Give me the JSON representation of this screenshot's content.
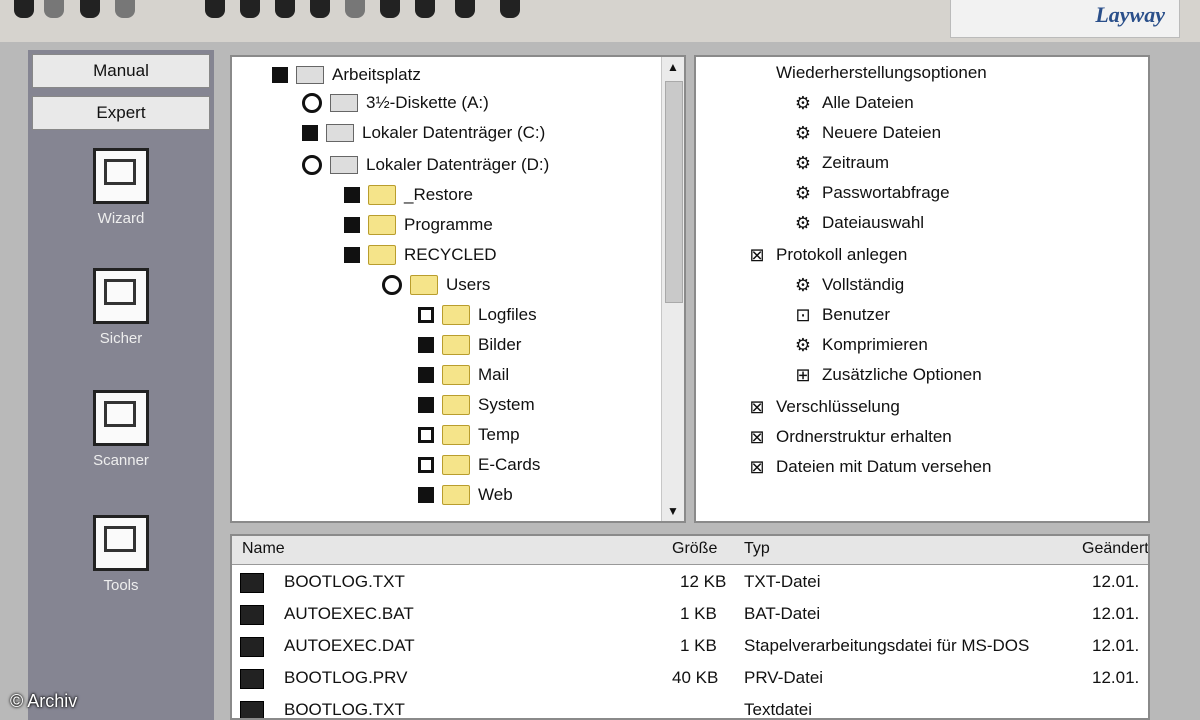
{
  "app": {
    "logo_text": "Layway"
  },
  "left_nav": {
    "buttons": [
      "Manual",
      "Expert"
    ],
    "tools": [
      "Wizard",
      "Sicher",
      "Scanner",
      "Tools"
    ]
  },
  "tree": {
    "items": [
      {
        "label": "Arbeitsplatz",
        "icon": "drive-icon",
        "check": "on"
      },
      {
        "label": "3½-Diskette (A:)",
        "icon": "floppy-icon",
        "check": "radio"
      },
      {
        "label": "Lokaler Datenträger (C:)",
        "icon": "drive-icon",
        "check": "on"
      },
      {
        "label": "Lokaler Datenträger (D:)",
        "icon": "drive-icon",
        "check": "radio"
      },
      {
        "label": "_Restore",
        "icon": "folder-icon",
        "check": "on"
      },
      {
        "label": "Programme",
        "icon": "folder-icon",
        "check": "on"
      },
      {
        "label": "RECYCLED",
        "icon": "folder-icon",
        "check": "on"
      },
      {
        "label": "Users",
        "icon": "folder-icon",
        "check": "radio"
      },
      {
        "label": "Logfiles",
        "icon": "folder-icon",
        "check": "off"
      },
      {
        "label": "Bilder",
        "icon": "folder-icon",
        "check": "on"
      },
      {
        "label": "Mail",
        "icon": "folder-icon",
        "check": "on"
      },
      {
        "label": "System",
        "icon": "folder-icon",
        "check": "on"
      },
      {
        "label": "Temp",
        "icon": "folder-icon",
        "check": "off"
      },
      {
        "label": "E-Cards",
        "icon": "folder-icon",
        "check": "off"
      },
      {
        "label": "Web",
        "icon": "folder-icon",
        "check": "on"
      }
    ]
  },
  "options": {
    "items": [
      {
        "label": "Wiederherstellungsoptionen",
        "glyph": ""
      },
      {
        "label": "Alle Dateien",
        "glyph": "⚙"
      },
      {
        "label": "Neuere Dateien",
        "glyph": "⚙"
      },
      {
        "label": "Zeitraum",
        "glyph": "⚙"
      },
      {
        "label": "Passwortabfrage",
        "glyph": "⚙"
      },
      {
        "label": "Dateiauswahl",
        "glyph": "⚙"
      },
      {
        "label": "Protokoll anlegen",
        "glyph": "⊠"
      },
      {
        "label": "Vollständig",
        "glyph": "⚙"
      },
      {
        "label": "Benutzer",
        "glyph": "⊡"
      },
      {
        "label": "Komprimieren",
        "glyph": "⚙"
      },
      {
        "label": "Zusätzliche Optionen",
        "glyph": "⊞"
      },
      {
        "label": "Verschlüsselung",
        "glyph": "⊠"
      },
      {
        "label": "Ordnerstruktur erhalten",
        "glyph": "⊠"
      },
      {
        "label": "Dateien mit Datum versehen",
        "glyph": "⊠"
      }
    ]
  },
  "file_list": {
    "headers": [
      "Name",
      "Größe",
      "Typ",
      "Geändert"
    ],
    "rows": [
      {
        "name": "BOOTLOG.TXT",
        "size": "12 KB",
        "type": "TXT-Datei",
        "date": "12.01."
      },
      {
        "name": "AUTOEXEC.BAT",
        "size": "1 KB",
        "type": "BAT-Datei",
        "date": "12.01."
      },
      {
        "name": "AUTOEXEC.DAT",
        "size": "1 KB",
        "type": "Stapelverarbeitungsdatei für MS-DOS",
        "date": "12.01."
      },
      {
        "name": "BOOTLOG.PRV",
        "size": "40 KB",
        "type": "PRV-Datei",
        "date": "12.01."
      },
      {
        "name": "BOOTLOG.TXT",
        "size": "",
        "type": "Textdatei",
        "date": ""
      }
    ]
  },
  "watermark": "© Archiv",
  "colors": {
    "nav_bg": "#858592",
    "frame": "#b9b9b9",
    "logo": "#2a4f8a",
    "folder": "#f5e48a"
  }
}
